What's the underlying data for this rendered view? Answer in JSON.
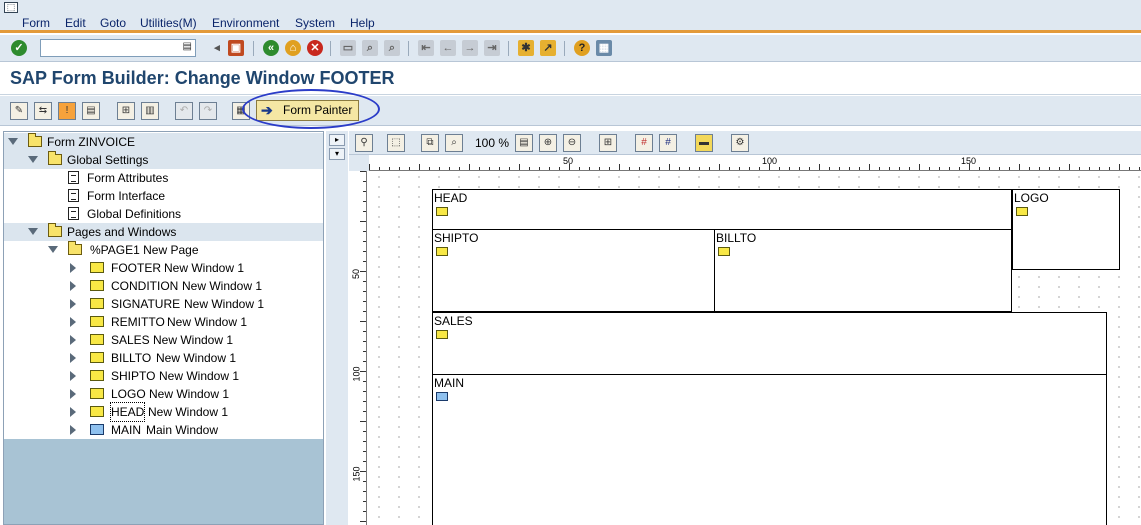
{
  "menu": {
    "items": [
      "Form",
      "Edit",
      "Goto",
      "Utilities(M)",
      "Environment",
      "System",
      "Help"
    ]
  },
  "standard_toolbar": {
    "command_field_value": "",
    "icons": [
      "enter-icon",
      "back-icon",
      "exit-icon",
      "cancel-icon",
      "print-icon",
      "find-icon",
      "find-next-icon",
      "first-page-icon",
      "previous-page-icon",
      "next-page-icon",
      "last-page-icon",
      "create-session-icon",
      "shortcut-icon",
      "help-icon",
      "customize-layout-icon"
    ]
  },
  "title": "SAP Form Builder: Change Window FOOTER",
  "app_toolbar": {
    "form_painter_label": "Form Painter"
  },
  "tree": {
    "root": "Form ZINVOICE",
    "global_settings": "Global Settings",
    "global_items": [
      "Form Attributes",
      "Form Interface",
      "Global Definitions"
    ],
    "pages_and_windows": "Pages and Windows",
    "page": "%PAGE1 New Page",
    "windows": [
      {
        "name": "FOOTER",
        "desc": "New Window 1",
        "type": "secondary"
      },
      {
        "name": "CONDITION",
        "desc": "New Window 1",
        "type": "secondary"
      },
      {
        "name": "SIGNATURE",
        "desc": "New Window 1",
        "type": "secondary"
      },
      {
        "name": "REMITTO",
        "desc": "New Window 1",
        "type": "secondary"
      },
      {
        "name": "SALES",
        "desc": "New Window 1",
        "type": "secondary"
      },
      {
        "name": "BILLTO",
        "desc": "New Window 1",
        "type": "secondary"
      },
      {
        "name": "SHIPTO",
        "desc": "New Window 1",
        "type": "secondary"
      },
      {
        "name": "LOGO",
        "desc": "New Window 1",
        "type": "secondary"
      },
      {
        "name": "HEAD",
        "desc": "New Window 1",
        "type": "secondary"
      },
      {
        "name": "MAIN",
        "desc": "Main Window",
        "type": "main"
      }
    ]
  },
  "painter": {
    "zoom": "100 %",
    "hruler_labels": [
      "50",
      "100",
      "150"
    ],
    "vruler_labels": [
      "50",
      "100",
      "150"
    ],
    "windows": {
      "head": "HEAD",
      "logo": "LOGO",
      "shipto": "SHIPTO",
      "billto": "BILLTO",
      "sales": "SALES",
      "main": "MAIN"
    }
  },
  "colors": {
    "menu_background": "#dfe8f1",
    "accent_line": "#e39a3a",
    "title_text": "#20466e",
    "annotation_circle": "#2b3cc8",
    "button_highlight": "#f5e7a4"
  }
}
